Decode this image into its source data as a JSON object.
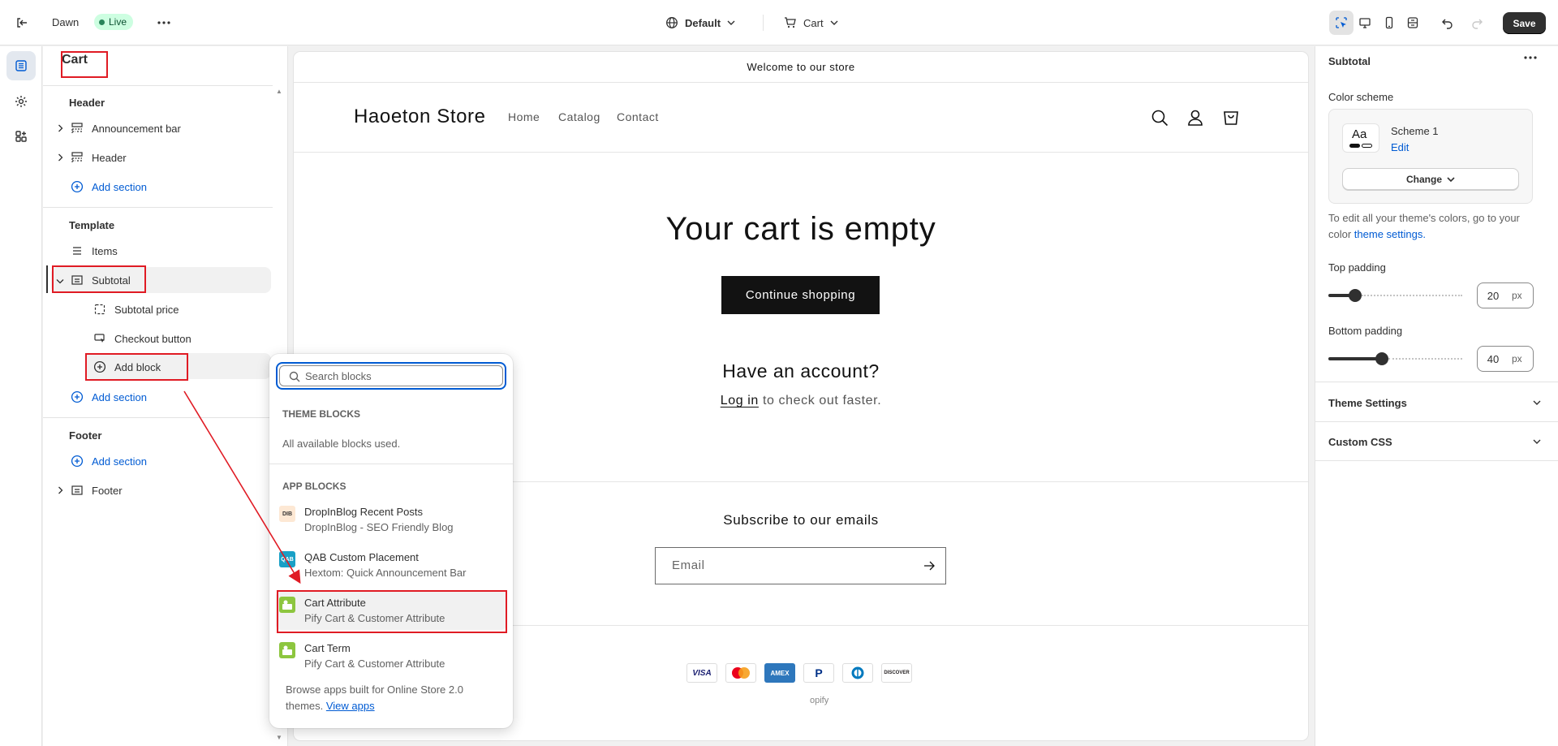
{
  "topbar": {
    "theme_name": "Dawn",
    "live_label": "Live",
    "template_dropdown": "Default",
    "page_dropdown": "Cart",
    "save_label": "Save"
  },
  "sidebar": {
    "title": "Cart",
    "header_group": "Header",
    "header_items": [
      "Announcement bar",
      "Header"
    ],
    "add_section": "Add section",
    "template_group": "Template",
    "items_label": "Items",
    "subtotal_label": "Subtotal",
    "subtotal_children": [
      "Subtotal price",
      "Checkout button"
    ],
    "add_block": "Add block",
    "footer_group": "Footer",
    "footer_item": "Footer"
  },
  "preview": {
    "announcement": "Welcome to our store",
    "logo": "Haoeton Store",
    "nav": [
      "Home",
      "Catalog",
      "Contact"
    ],
    "empty_title": "Your cart is empty",
    "continue_button": "Continue shopping",
    "account_title": "Have an account?",
    "login_link": "Log in",
    "login_rest": " to check out faster.",
    "subscribe_title": "Subscribe to our emails",
    "email_placeholder": "Email",
    "payments": [
      "VISA",
      "MC",
      "AMEX",
      "PayPal",
      "Diners",
      "DISCOVER"
    ],
    "copyright_fragment": "opify"
  },
  "right_panel": {
    "title": "Subtotal",
    "color_scheme_label": "Color scheme",
    "scheme_swatch": "Aa",
    "scheme_name": "Scheme 1",
    "edit_link": "Edit",
    "change_button": "Change",
    "note_text": "To edit all your theme's colors, go to your color ",
    "note_link": "theme settings.",
    "top_padding_label": "Top padding",
    "top_padding_value": "20",
    "bottom_padding_label": "Bottom padding",
    "bottom_padding_value": "40",
    "unit": "px",
    "top_padding_fraction": 0.2,
    "bottom_padding_fraction": 0.4,
    "theme_settings": "Theme Settings",
    "custom_css": "Custom CSS"
  },
  "popover": {
    "search_placeholder": "Search blocks",
    "theme_blocks_heading": "THEME BLOCKS",
    "theme_blocks_note": "All available blocks used.",
    "app_blocks_heading": "APP BLOCKS",
    "apps": [
      {
        "name": "DropInBlog Recent Posts",
        "vendor": "DropInBlog - SEO Friendly Blog",
        "icon": "DIB"
      },
      {
        "name": "QAB Custom Placement",
        "vendor": "Hextom: Quick Announcement Bar",
        "icon": "QAB"
      },
      {
        "name": "Cart Attribute",
        "vendor": "Pify Cart & Customer Attribute",
        "icon": "pify"
      },
      {
        "name": "Cart Term",
        "vendor": "Pify Cart & Customer Attribute",
        "icon": "pify"
      }
    ],
    "footer_text": "Browse apps built for Online Store 2.0 themes. ",
    "footer_link": "View apps"
  },
  "colors": {
    "accent": "#005bd3",
    "annotation_red": "#e01b24",
    "live_badge": "#cdfee1"
  }
}
